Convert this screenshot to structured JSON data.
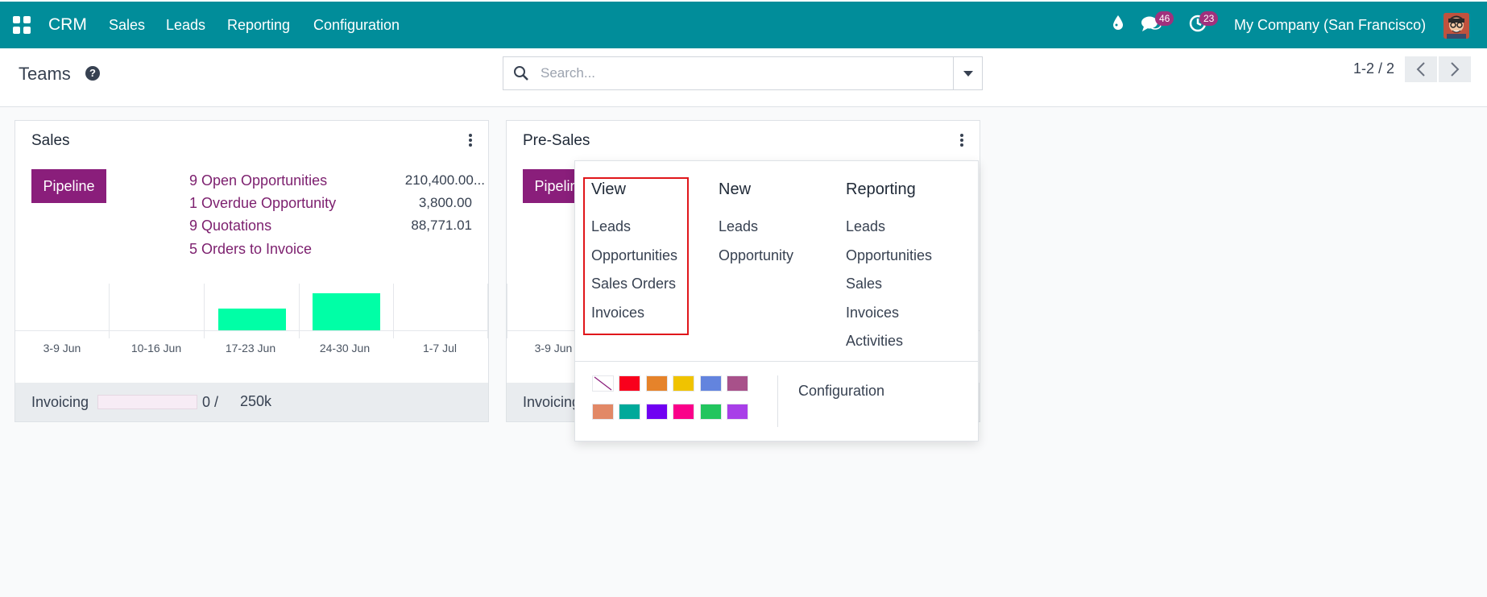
{
  "navbar": {
    "brand": "CRM",
    "menu": [
      "Sales",
      "Leads",
      "Reporting",
      "Configuration"
    ],
    "messages_count": "46",
    "activities_count": "23",
    "company": "My Company (San Francisco)"
  },
  "control": {
    "title": "Teams",
    "search_placeholder": "Search...",
    "pager": "1-2 / 2"
  },
  "cards": [
    {
      "title": "Sales",
      "pipeline_label": "Pipeline",
      "stats": [
        {
          "label": "9 Open Opportunities",
          "value": "210,400.00..."
        },
        {
          "label": "1 Overdue Opportunity",
          "value": "3,800.00"
        },
        {
          "label": "9 Quotations",
          "value": "88,771.01"
        },
        {
          "label": "5 Orders to Invoice",
          "value": ""
        }
      ],
      "graph": {
        "categories": [
          "3-9 Jun",
          "10-16 Jun",
          "17-23 Jun",
          "24-30 Jun",
          "1-7 Jul"
        ],
        "values": [
          0,
          0,
          28,
          48,
          0
        ]
      },
      "footer_label": "Invoicing",
      "footer_value": "0 /",
      "footer_target": "250k",
      "invoicing_progress": 0
    },
    {
      "title": "Pre-Sales",
      "pipeline_label": "Pipeline",
      "graph_first_label": "3-9 Jun",
      "footer_label": "Invoicing"
    }
  ],
  "dropdown": {
    "columns": [
      {
        "title": "View",
        "items": [
          "Leads",
          "Opportunities",
          "Sales Orders",
          "Invoices"
        ]
      },
      {
        "title": "New",
        "items": [
          "Leads",
          "Opportunity"
        ]
      },
      {
        "title": "Reporting",
        "items": [
          "Leads",
          "Opportunities",
          "Sales",
          "Invoices",
          "Activities"
        ]
      }
    ],
    "colors": [
      "none",
      "#f9001c",
      "#e6832a",
      "#f0c300",
      "#6384de",
      "#a8518a",
      "#e28866",
      "#00a99a",
      "#7000f2",
      "#fa008a",
      "#22c55e",
      "#a83fe8"
    ],
    "configuration_label": "Configuration"
  }
}
